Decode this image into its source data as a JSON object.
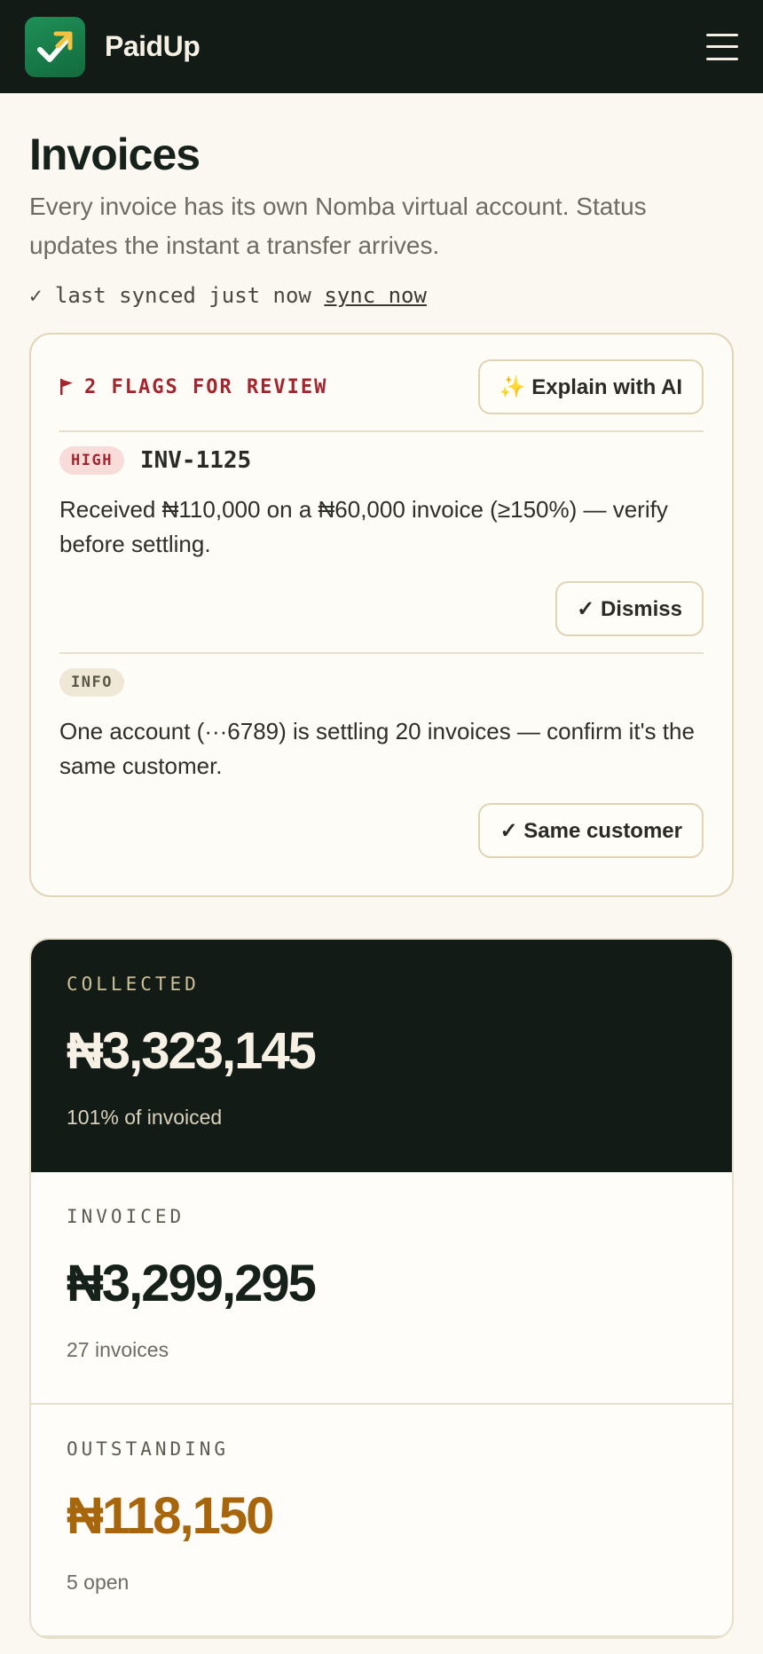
{
  "app": {
    "name": "PaidUp",
    "logo_icon": "chart-check-logo-icon",
    "menu_icon": "hamburger-menu-icon"
  },
  "colors": {
    "topbar": "#131b16",
    "accent_green": "#1f8f57",
    "flag_red": "#a3262f",
    "outstanding_amber": "#a8660c"
  },
  "page": {
    "title": "Invoices",
    "subtitle": "Every invoice has its own Nomba virtual account. Status updates the instant a transfer arrives.",
    "sync_status": "✓ last synced just now",
    "sync_link": "sync now"
  },
  "flags": {
    "title": "2 FLAGS FOR REVIEW",
    "icon": "flag-icon",
    "explain_button": "✨ Explain with AI",
    "items": [
      {
        "severity": "HIGH",
        "invoice_id": "INV-1125",
        "message": "Received ₦110,000 on a ₦60,000 invoice (≥150%) — verify before settling.",
        "action": "✓ Dismiss"
      },
      {
        "severity": "INFO",
        "message": "One account (···6789) is settling 20 invoices — confirm it's the same customer.",
        "action": "✓ Same customer"
      }
    ]
  },
  "stats": [
    {
      "label": "COLLECTED",
      "value": "₦3,323,145",
      "note": "101% of invoiced"
    },
    {
      "label": "INVOICED",
      "value": "₦3,299,295",
      "note": "27 invoices"
    },
    {
      "label": "OUTSTANDING",
      "value": "₦118,150",
      "note": "5 open"
    }
  ]
}
